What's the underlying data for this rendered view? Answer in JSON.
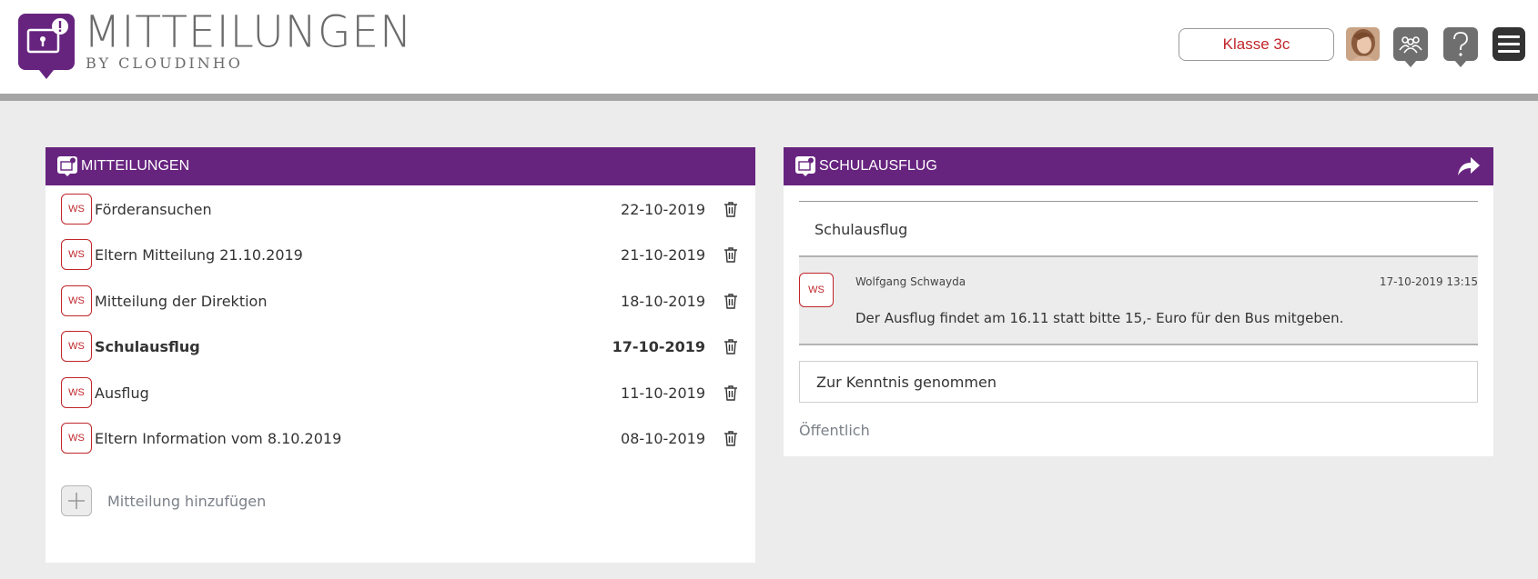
{
  "header": {
    "app_title": "MITTEILUNGEN",
    "app_subtitle": "BY CLOUDINHO",
    "class_button_label": "Klasse 3c",
    "icons": [
      "messages-logo-icon",
      "profile-avatar",
      "groups-icon",
      "help-icon",
      "menu-icon"
    ]
  },
  "left_panel": {
    "title": "MITTEILUNGEN",
    "messages": [
      {
        "badge": "WS",
        "title": "Förderansuchen",
        "date": "22-10-2019",
        "active": false
      },
      {
        "badge": "WS",
        "title": "Eltern Mitteilung 21.10.2019",
        "date": "21-10-2019",
        "active": false
      },
      {
        "badge": "WS",
        "title": "Mitteilung der Direktion",
        "date": "18-10-2019",
        "active": false
      },
      {
        "badge": "WS",
        "title": "Schulausflug",
        "date": "17-10-2019",
        "active": true
      },
      {
        "badge": "WS",
        "title": "Ausflug",
        "date": "11-10-2019",
        "active": false
      },
      {
        "badge": "WS",
        "title": "Eltern Information vom 8.10.2019",
        "date": "08-10-2019",
        "active": false
      }
    ],
    "add_label": "Mitteilung hinzufügen"
  },
  "right_panel": {
    "title": "SCHULAUSFLUG",
    "subject": "Schulausflug",
    "message": {
      "badge": "WS",
      "author": "Wolfgang Schwayda",
      "timestamp": "17-10-2019 13:15",
      "body": "Der Ausflug findet am 16.11 statt bitte 15,- Euro für den Bus mitgeben."
    },
    "acknowledge_label": "Zur Kenntnis genommen",
    "visibility": "Öffentlich"
  },
  "colors": {
    "purple": "#67247f",
    "accent_red": "#c0262b",
    "background": "#ececec",
    "icon_gray": "#6f6f6f"
  }
}
